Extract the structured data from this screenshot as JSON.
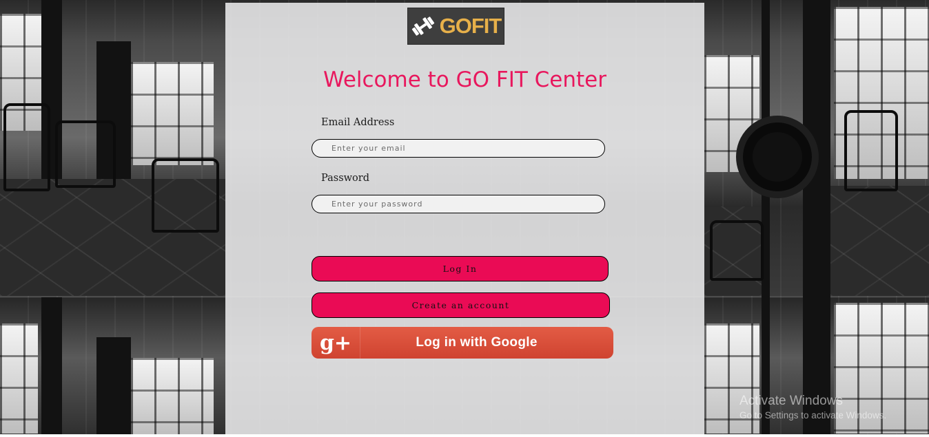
{
  "logo": {
    "text": "GOFIT"
  },
  "page": {
    "welcome_title": "Welcome to GO FIT Center"
  },
  "form": {
    "email_label": "Email Address",
    "email_placeholder": "Enter your email",
    "email_value": "",
    "password_label": "Password",
    "password_placeholder": "Enter your password",
    "password_value": ""
  },
  "buttons": {
    "login_label": "Log In",
    "create_account_label": "Create an account",
    "google_label": "Log in with Google",
    "google_icon_text": "g+"
  },
  "watermark": {
    "title": "Activate Windows",
    "subtitle": "Go to Settings to activate Windows."
  },
  "colors": {
    "accent": "#e8175d",
    "button": "#ea0b55",
    "google": "#d94b36",
    "logo_text": "#e7b04a"
  },
  "icons": [
    "dumbbell-icon",
    "google-plus-icon"
  ]
}
